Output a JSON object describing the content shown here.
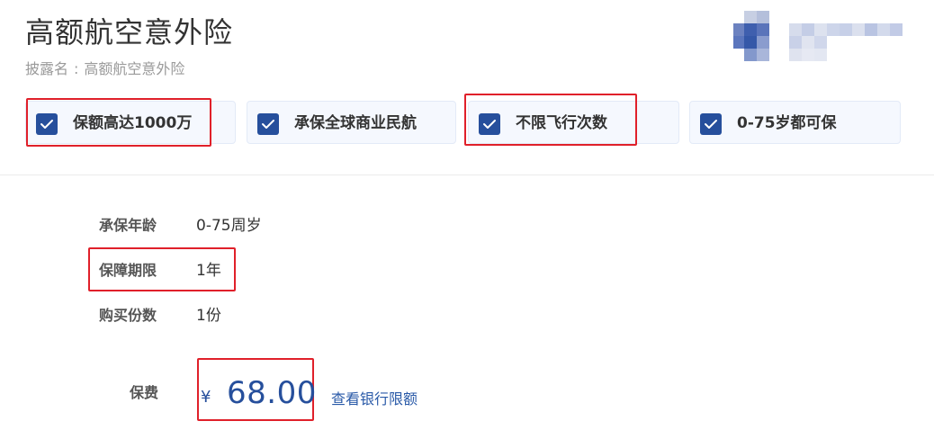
{
  "product": {
    "title": "高额航空意外险",
    "disclosure_label": "披露名",
    "disclosure_sep": ":",
    "disclosure_value": "高额航空意外险"
  },
  "features": [
    {
      "label": "保额高达1000万",
      "checked": true
    },
    {
      "label": "承保全球商业民航",
      "checked": true
    },
    {
      "label": "不限飞行次数",
      "checked": true
    },
    {
      "label": "0-75岁都可保",
      "checked": true
    }
  ],
  "info": [
    {
      "label": "承保年龄",
      "value": "0-75周岁"
    },
    {
      "label": "保障期限",
      "value": "1年"
    },
    {
      "label": "购买份数",
      "value": "1份"
    }
  ],
  "price": {
    "label": "保费",
    "currency": "¥",
    "amount": "68.00",
    "bank_limit_link": "查看银行限额"
  },
  "colors": {
    "brand_blue": "#264f9c",
    "highlight_red": "#e0202a",
    "feature_bg": "#f5f8fe"
  },
  "icons": {
    "checkbox": "checkbox-checked-icon",
    "logo": "company-logo"
  }
}
